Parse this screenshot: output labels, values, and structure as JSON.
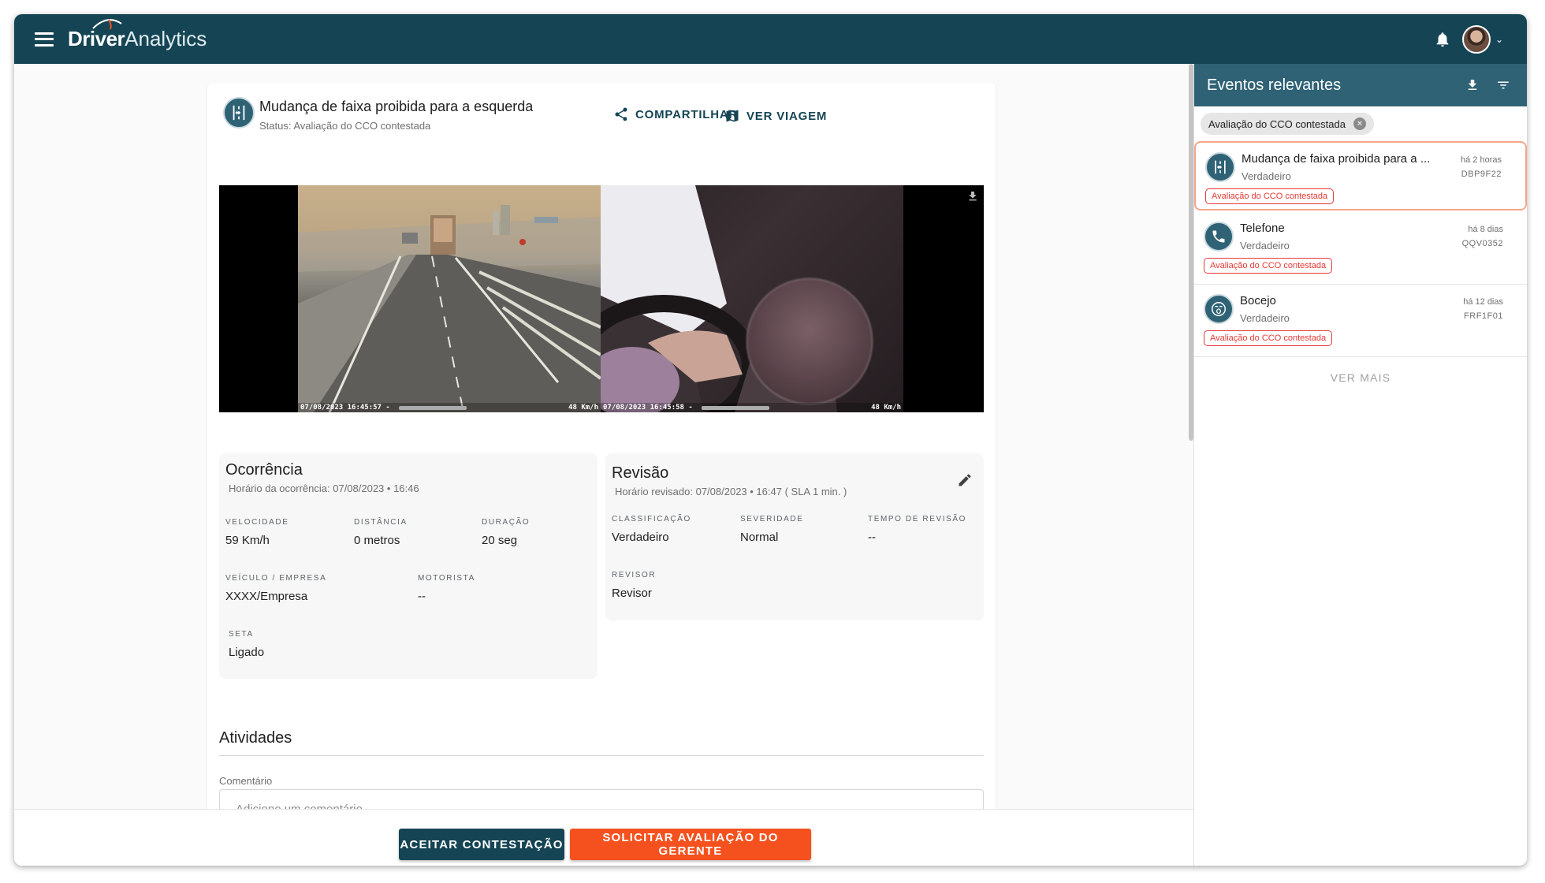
{
  "app": {
    "logo_main": "Driver",
    "logo_sub": "Analytics"
  },
  "event": {
    "title": "Mudança de faixa proibida para a esquerda",
    "status": "Status: Avaliação do CCO contestada",
    "share_label": "COMPARTILHAR",
    "trip_label": "VER VIAGEM"
  },
  "video": {
    "cam1": {
      "timestamp": "07/08/2023 16:45:57 -",
      "speed": "48 Km/h"
    },
    "cam2": {
      "timestamp": "07/08/2023 16:45:58 -",
      "speed": "48 Km/h"
    }
  },
  "ocorrencia": {
    "title": "Ocorrência",
    "subtitle": "Horário da ocorrência: 07/08/2023 • 16:46",
    "fields": [
      {
        "label": "VELOCIDADE",
        "value": "59 Km/h"
      },
      {
        "label": "DISTÂNCIA",
        "value": "0 metros"
      },
      {
        "label": "DURAÇÃO",
        "value": "20 seg"
      },
      {
        "label": "VEÍCULO / EMPRESA",
        "value": "XXXX/Empresa"
      },
      {
        "label": "MOTORISTA",
        "value": "--"
      },
      {
        "label": "SETA",
        "value": "Ligado"
      }
    ]
  },
  "revisao": {
    "title": "Revisão",
    "subtitle": "Horário revisado: 07/08/2023 • 16:47 ( SLA 1 min. )",
    "fields": [
      {
        "label": "CLASSIFICAÇÃO",
        "value": "Verdadeiro"
      },
      {
        "label": "SEVERIDADE",
        "value": "Normal"
      },
      {
        "label": "TEMPO DE REVISÃO",
        "value": "--"
      },
      {
        "label": "REVISOR",
        "value": "Revisor"
      }
    ]
  },
  "atividades": {
    "title": "Atividades",
    "comment_label": "Comentário",
    "comment_placeholder": "Adicione um comentário"
  },
  "actions": {
    "accept": "ACEITAR CONTESTAÇÃO",
    "request": "SOLICITAR AVALIAÇÃO DO GERENTE"
  },
  "sidebar": {
    "title": "Eventos relevantes",
    "filter_chip": "Avaliação do CCO contestada",
    "items": [
      {
        "name": "Mudança de faixa proibida para a ...",
        "classification": "Verdadeiro",
        "time": "há 2 horas",
        "plate": "DBP9F22",
        "badge": "Avaliação do CCO contestada",
        "icon": "lane-change-icon"
      },
      {
        "name": "Telefone",
        "classification": "Verdadeiro",
        "time": "há 8 dias",
        "plate": "QQV0352",
        "badge": "Avaliação do CCO contestada",
        "icon": "phone-icon"
      },
      {
        "name": "Bocejo",
        "classification": "Verdadeiro",
        "time": "há 12 dias",
        "plate": "FRF1F01",
        "badge": "Avaliação do CCO contestada",
        "icon": "yawn-icon"
      }
    ],
    "more_label": "VER MAIS"
  },
  "colors": {
    "topbar": "#154555",
    "accent": "#2f6275",
    "primary_button": "#154555",
    "secondary_button": "#f4511e",
    "badge": "#e53935"
  }
}
